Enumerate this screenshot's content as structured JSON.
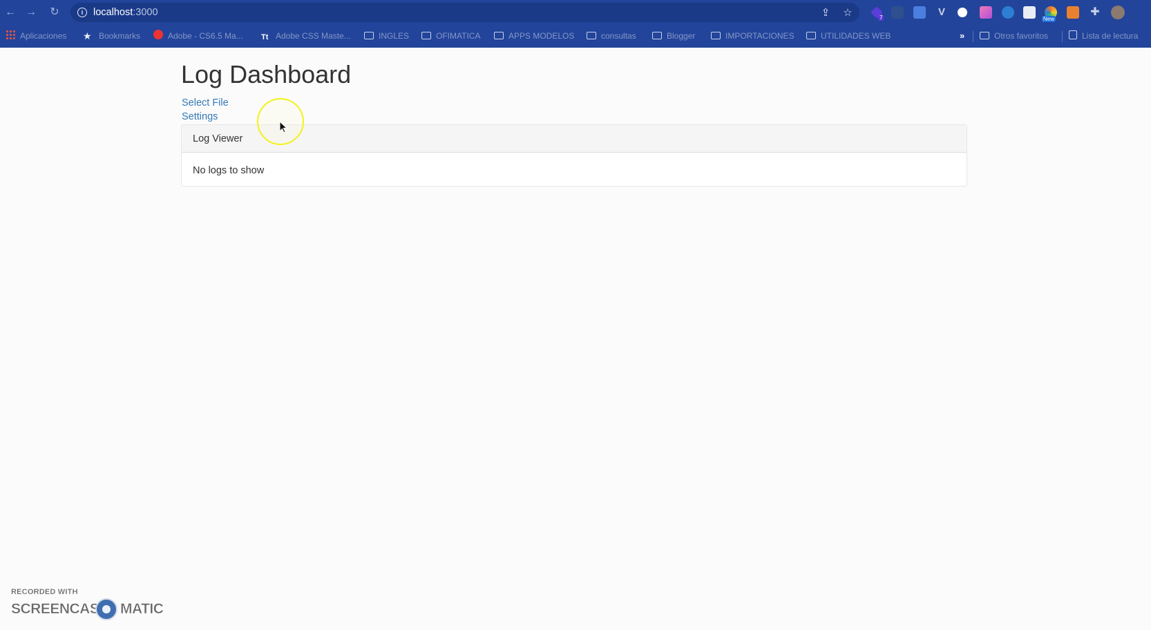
{
  "browser": {
    "url_host": "localhost",
    "url_port": ":3000",
    "nav": {
      "back_glyph": "←",
      "forward_glyph": "→",
      "reload_glyph": "↻"
    },
    "extensions": [
      {
        "name": "gem-icon",
        "color": "#5b3dd8",
        "badge": "7"
      },
      {
        "name": "recycle-icon",
        "color": "#2f4f8e"
      },
      {
        "name": "translate-icon",
        "color": "#4a7fe0"
      },
      {
        "name": "v-icon",
        "color": "#c8d2ea"
      },
      {
        "name": "face-icon",
        "color": "#ffffff"
      },
      {
        "name": "gradient-icon",
        "color": "#d94fa8"
      },
      {
        "name": "search-ext-icon",
        "color": "#2d7fd3"
      },
      {
        "name": "note-icon",
        "color": "#e9edf5"
      },
      {
        "name": "rainbow-icon",
        "color": "#f07a2b",
        "badge": "New"
      },
      {
        "name": "fox-icon",
        "color": "#e8822e"
      },
      {
        "name": "puzzle-icon",
        "color": "#c8d2ea"
      },
      {
        "name": "avatar",
        "color": "#8a7a70"
      }
    ],
    "bookmarks": [
      {
        "label": "Aplicaciones",
        "icon": "apps-icon"
      },
      {
        "label": "Bookmarks",
        "icon": "star-icon"
      },
      {
        "label": "Adobe - CS6.5 Ma...",
        "icon": "adobe-icon"
      },
      {
        "label": "Adobe CSS Maste...",
        "icon": "text-icon"
      },
      {
        "label": "INGLES",
        "icon": "folder-icon"
      },
      {
        "label": "OFIMATICA",
        "icon": "folder-icon"
      },
      {
        "label": "APPS MODELOS",
        "icon": "folder-icon"
      },
      {
        "label": "consultas",
        "icon": "folder-icon"
      },
      {
        "label": "Blogger",
        "icon": "folder-icon"
      },
      {
        "label": "IMPORTACIONES",
        "icon": "folder-icon"
      },
      {
        "label": "UTILIDADES WEB",
        "icon": "folder-icon"
      }
    ],
    "bookmarks_more": "»",
    "other_favorites": "Otros favoritos",
    "reading_list": "Lista de lectura"
  },
  "page": {
    "title": "Log Dashboard",
    "links": [
      "Select File",
      "Settings"
    ],
    "panel": {
      "heading": "Log Viewer",
      "body": "No logs to show"
    }
  },
  "watermark": {
    "small": "RECORDED WITH",
    "left": "SCREENCAST",
    "right": "MATIC"
  }
}
